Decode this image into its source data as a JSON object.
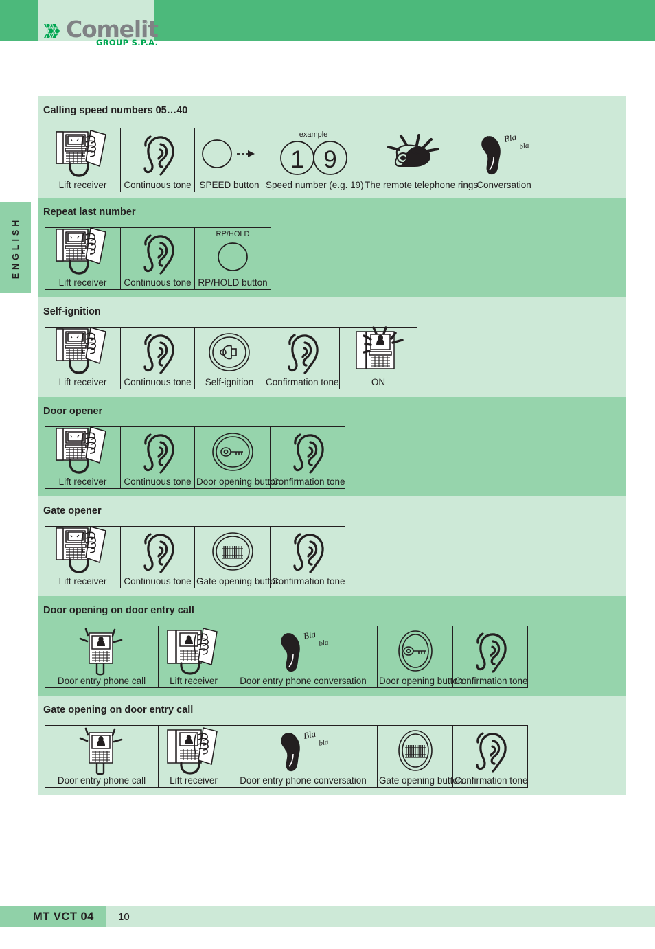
{
  "header": {
    "logo_word": "Comelit",
    "logo_registered": "®",
    "logo_sub": "GROUP S.P.A.",
    "logo_mark_color": "#00a651",
    "logo_word_color": "#808285",
    "bar_color": "#4cb97b",
    "panel_color": "#cde9d7"
  },
  "side_tab": {
    "label": "ENGLISH",
    "color": "#90d1a8"
  },
  "palette": {
    "band_light": "#cde9d7",
    "band_dark": "#96d4ac",
    "ink": "#231f20",
    "green_accent": "#00a651"
  },
  "sections": [
    {
      "title": "Calling speed numbers 05…40",
      "band": "light",
      "steps": [
        {
          "icon": "telephone-lift-receiver-icon",
          "label": "Lift receiver",
          "caption": ""
        },
        {
          "icon": "ear-icon",
          "label": "Continuous tone",
          "caption": ""
        },
        {
          "icon": "speed-button-arrow-icon",
          "label": "SPEED button",
          "caption": ""
        },
        {
          "icon": "speed-number-digits-icon",
          "label": "Speed number (e.g. 19)",
          "caption": "example",
          "digits": [
            "1",
            "9"
          ]
        },
        {
          "icon": "ringing-telephone-icon",
          "label": "The remote telephone rings",
          "caption": ""
        },
        {
          "icon": "conversation-bla-bla-icon",
          "label": "Conversation",
          "caption": "",
          "bla": [
            "Bla",
            "bla"
          ]
        }
      ]
    },
    {
      "title": "Repeat last number",
      "band": "dark",
      "steps": [
        {
          "icon": "telephone-lift-receiver-icon",
          "label": "Lift receiver",
          "caption": ""
        },
        {
          "icon": "ear-icon",
          "label": "Continuous tone",
          "caption": ""
        },
        {
          "icon": "rp-hold-button-icon",
          "label": "RP/HOLD button",
          "caption": "RP/HOLD"
        }
      ]
    },
    {
      "title": "Self-ignition",
      "band": "light",
      "steps": [
        {
          "icon": "telephone-lift-receiver-icon",
          "label": "Lift receiver",
          "caption": ""
        },
        {
          "icon": "ear-icon",
          "label": "Continuous tone",
          "caption": ""
        },
        {
          "icon": "self-ignition-lamp-button-icon",
          "label": "Self-ignition",
          "caption": ""
        },
        {
          "icon": "ear-icon",
          "label": "Confirmation tone",
          "caption": ""
        },
        {
          "icon": "entrance-panel-on-icon",
          "label": "ON",
          "caption": ""
        }
      ]
    },
    {
      "title": "Door opener",
      "band": "dark",
      "steps": [
        {
          "icon": "telephone-lift-receiver-icon",
          "label": "Lift receiver",
          "caption": ""
        },
        {
          "icon": "ear-icon",
          "label": "Continuous tone",
          "caption": ""
        },
        {
          "icon": "key-door-opening-button-icon",
          "label": "Door opening button",
          "caption": ""
        },
        {
          "icon": "ear-icon",
          "label": "Confirmation tone",
          "caption": ""
        }
      ]
    },
    {
      "title": "Gate opener",
      "band": "light",
      "steps": [
        {
          "icon": "telephone-lift-receiver-icon",
          "label": "Lift receiver",
          "caption": ""
        },
        {
          "icon": "ear-icon",
          "label": "Continuous tone",
          "caption": ""
        },
        {
          "icon": "gate-opening-button-icon",
          "label": "Gate opening button",
          "caption": ""
        },
        {
          "icon": "ear-icon",
          "label": "Confirmation tone",
          "caption": ""
        }
      ]
    },
    {
      "title": "Door opening on door entry call",
      "band": "dark",
      "steps": [
        {
          "icon": "door-entry-phone-ringing-icon",
          "label": "Door entry phone call",
          "caption": ""
        },
        {
          "icon": "door-entry-phone-lift-receiver-icon",
          "label": "Lift receiver",
          "caption": ""
        },
        {
          "icon": "conversation-bla-bla-icon",
          "label": "Door entry phone conversation",
          "caption": "",
          "bla": [
            "Bla",
            "bla"
          ]
        },
        {
          "icon": "key-door-opening-button-oval-icon",
          "label": "Door opening button",
          "caption": ""
        },
        {
          "icon": "ear-icon",
          "label": "Confirmation tone",
          "caption": ""
        }
      ]
    },
    {
      "title": "Gate opening on door entry call",
      "band": "light",
      "steps": [
        {
          "icon": "door-entry-phone-ringing-icon",
          "label": "Door entry phone call",
          "caption": ""
        },
        {
          "icon": "door-entry-phone-lift-receiver-icon",
          "label": "Lift receiver",
          "caption": ""
        },
        {
          "icon": "conversation-bla-bla-icon",
          "label": "Door entry phone conversation",
          "caption": "",
          "bla": [
            "Bla",
            "bla"
          ]
        },
        {
          "icon": "gate-opening-button-oval-icon",
          "label": "Gate opening button",
          "caption": ""
        },
        {
          "icon": "ear-icon",
          "label": "Confirmation tone",
          "caption": ""
        }
      ]
    }
  ],
  "footer": {
    "code": "MT VCT 04",
    "page": "10"
  }
}
